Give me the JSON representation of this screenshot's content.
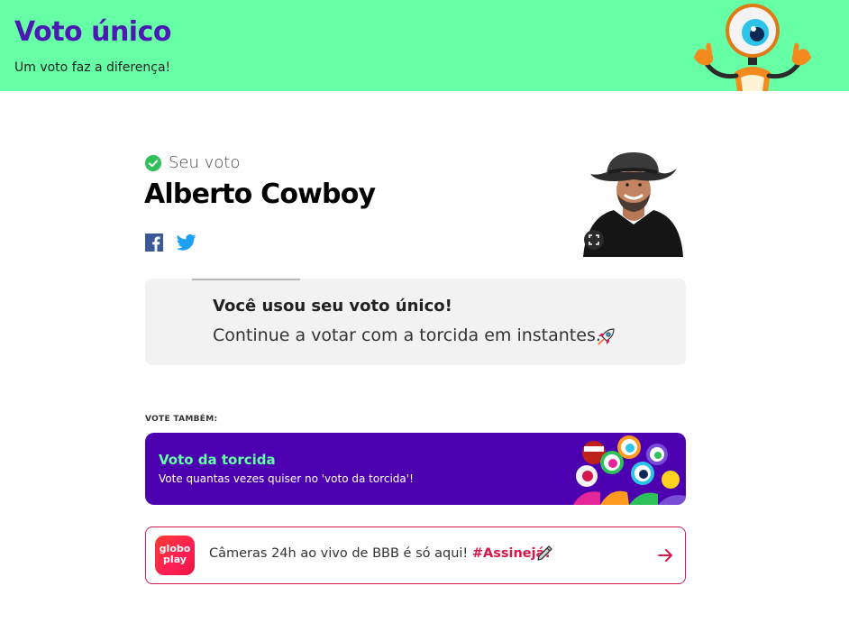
{
  "header": {
    "title": "Voto único",
    "subtitle": "Um voto faz a diferença!",
    "background_color": "#66ffa6",
    "title_color": "#4b1bb1",
    "mascot_icon": "big-brother-eye-mascot"
  },
  "vote": {
    "label": "Seu voto",
    "candidate": "Alberto Cowboy",
    "check_icon": "check-circle-icon",
    "share": {
      "facebook_icon": "facebook-icon",
      "twitter_icon": "twitter-icon"
    },
    "photo_icon": "candidate-photo",
    "expand_icon": "expand-icon"
  },
  "info": {
    "title": "Você usou seu voto único!",
    "text": "Continue a votar com a torcida em instantes.",
    "icon": "rocket-icon",
    "progress": 0.2
  },
  "also_vote": {
    "label": "VOTE TAMBÉM:",
    "card": {
      "title": "Voto da torcida",
      "subtitle": "Vote quantas vezes quiser no 'voto da torcida'!",
      "background_color": "#4d00b0",
      "title_color": "#66ffa6"
    }
  },
  "globoplay": {
    "logo_line1": "globo",
    "logo_line2": "play",
    "text": "Câmeras 24h ao vivo de BBB é só aqui! ",
    "hashtag": "#Assinejá!",
    "pen_icon": "pencil-icon",
    "arrow_icon": "arrow-right-icon",
    "accent_color": "#d6174b"
  }
}
